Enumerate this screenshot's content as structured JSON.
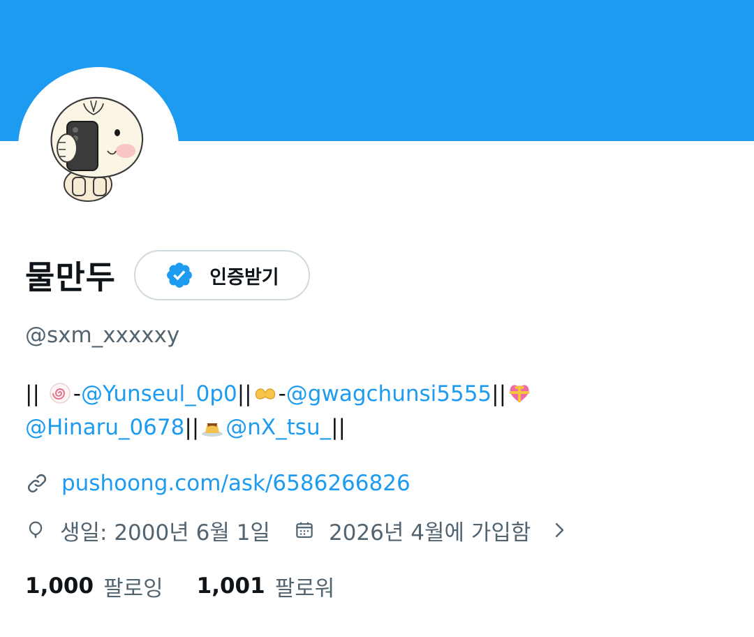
{
  "colors": {
    "banner": "#1d9bf0",
    "accent": "#1d9bf0",
    "muted": "#536471",
    "text": "#0f1419"
  },
  "profile": {
    "display_name": "물만두",
    "verify_label": "인증받기",
    "verify_icon": "verified-badge-icon",
    "handle": "@sxm_xxxxxy"
  },
  "bio": {
    "sep1": "|| ",
    "emoji1": "fish-cake-emoji",
    "dash1": "-",
    "mention1": "@Yunseul_0p0",
    "sep2": "||",
    "emoji2": "heart-hands-emoji",
    "dash2": "-",
    "mention2": "@gwagchunsi5555",
    "sep3": "||",
    "emoji3": "heart-with-ribbon-emoji",
    "mention3": "@Hinaru_0678",
    "sep4": "||",
    "emoji4": "custard-emoji",
    "mention4": "@nX_tsu_",
    "sep5": "||"
  },
  "link": {
    "icon": "link-icon",
    "text": "pushoong.com/ask/6586266826"
  },
  "meta": {
    "birthday_icon": "balloon-icon",
    "birthday": "생일: 2000년 6월 1일",
    "joined_icon": "calendar-icon",
    "joined": "2026년 4월에 가입함",
    "chevron_icon": "chevron-right-icon"
  },
  "follow": {
    "following_count": "1,000",
    "following_label": "팔로잉",
    "followers_count": "1,001",
    "followers_label": "팔로워"
  }
}
